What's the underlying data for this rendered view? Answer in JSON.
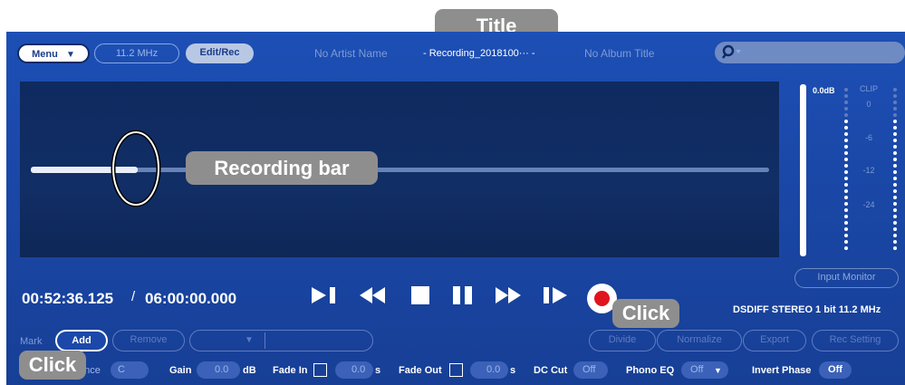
{
  "header": {
    "menu_label": "Menu",
    "menu_icon": "chevron-down-icon",
    "sample_rate_label": "11.2 MHz",
    "edit_rec_label": "Edit/Rec",
    "artist_name": "No Artist Name",
    "track_title": "- Recording_2018100··· -",
    "album_title": "No Album Title",
    "search_icon": "search-icon"
  },
  "meter": {
    "db_label": "0.0dB",
    "clip_label": "CLIP",
    "scale": [
      "0",
      "-6",
      "-12",
      "-24"
    ],
    "input_monitor_label": "Input Monitor"
  },
  "recording": {
    "progress_fraction": 0.145
  },
  "transport": {
    "time_current": "00:52:36.125",
    "time_separator": "/",
    "time_total": "06:00:00.000",
    "buttons": [
      "skip-to-start-icon",
      "rewind-icon",
      "stop-icon",
      "pause-icon",
      "fast-forward-icon",
      "skip-to-end-icon",
      "record-icon"
    ],
    "format_info": "DSDIFF STEREO 1 bit 11.2 MHz"
  },
  "mark": {
    "label": "Mark",
    "add_label": "Add",
    "remove_label": "Remove"
  },
  "actions": {
    "divide_label": "Divide",
    "normalize_label": "Normalize",
    "export_label": "Export",
    "rec_setting_label": "Rec Setting"
  },
  "settings": {
    "balance_label": "ance",
    "balance_value": "C",
    "gain_label": "Gain",
    "gain_value": "0.0",
    "gain_unit": "dB",
    "fade_in_label": "Fade In",
    "fade_in_value": "0.0",
    "fade_in_unit": "s",
    "fade_out_label": "Fade Out",
    "fade_out_value": "0.0",
    "fade_out_unit": "s",
    "dc_cut_label": "DC Cut",
    "dc_cut_value": "Off",
    "phono_eq_label": "Phono EQ",
    "phono_eq_value": "Off",
    "invert_phase_label": "Invert Phase",
    "invert_phase_value": "Off"
  },
  "annotations": {
    "title_callout": "Title",
    "recording_bar_callout": "Recording bar",
    "click_record": "Click",
    "click_add": "Click"
  },
  "colors": {
    "panel_blue": "#1d4fb5",
    "wave_bg": "#112e66",
    "record_red": "#e0141d",
    "callout_gray": "#8e8e8e"
  }
}
